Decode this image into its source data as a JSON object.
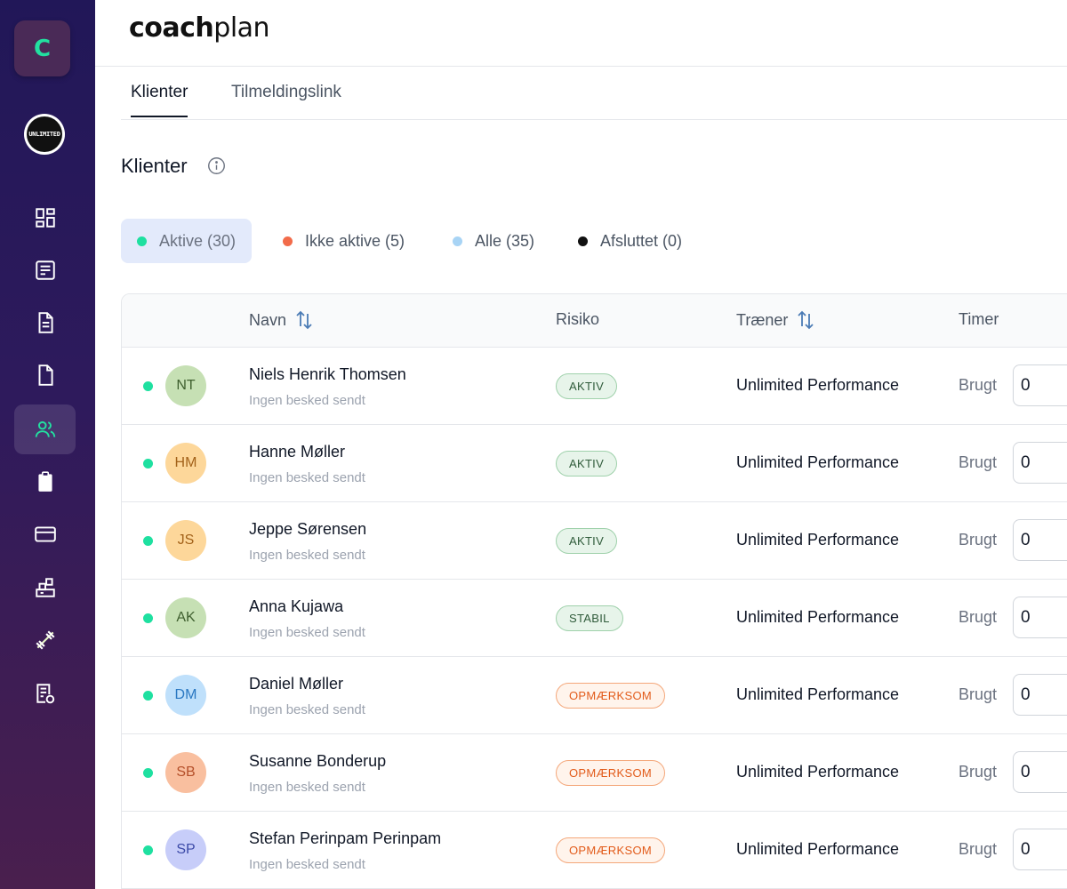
{
  "sidebar": {
    "app_initial": "C",
    "org_logo_text": "UNLIMITED",
    "nav": [
      {
        "icon": "dashboard-icon"
      },
      {
        "icon": "form-icon"
      },
      {
        "icon": "document-icon"
      },
      {
        "icon": "file-icon"
      },
      {
        "icon": "users-icon",
        "active": true
      },
      {
        "icon": "clipboard-icon"
      },
      {
        "icon": "credit-card-icon"
      },
      {
        "icon": "blocks-icon"
      },
      {
        "icon": "dumbbell-icon"
      },
      {
        "icon": "report-icon"
      }
    ]
  },
  "header": {
    "brand_bold": "coach",
    "brand_light": "plan"
  },
  "tabs": [
    {
      "label": "Klienter",
      "active": true
    },
    {
      "label": "Tilmeldingslink",
      "active": false
    }
  ],
  "section": {
    "title": "Klienter"
  },
  "filters": [
    {
      "label": "Aktive (30)",
      "color": "#1ee0a0",
      "active": true
    },
    {
      "label": "Ikke aktive (5)",
      "color": "#f26b4a",
      "active": false
    },
    {
      "label": "Alle (35)",
      "color": "#a8d4f5",
      "active": false
    },
    {
      "label": "Afsluttet (0)",
      "color": "#111111",
      "active": false
    }
  ],
  "table": {
    "headers": {
      "name": "Navn",
      "risk": "Risiko",
      "coach": "Træner",
      "hours": "Timer"
    },
    "rows": [
      {
        "initials": "NT",
        "avatar_bg": "#c6e0b4",
        "avatar_fg": "#3f5f2f",
        "name": "Niels Henrik Thomsen",
        "sub": "Ingen besked sendt",
        "risk": "AKTIV",
        "risk_tone": "green",
        "coach": "Unlimited Performance",
        "used_label": "Brugt",
        "used": "0"
      },
      {
        "initials": "HM",
        "avatar_bg": "#fdd79a",
        "avatar_fg": "#a3621a",
        "name": "Hanne Møller",
        "sub": "Ingen besked sendt",
        "risk": "AKTIV",
        "risk_tone": "green",
        "coach": "Unlimited Performance",
        "used_label": "Brugt",
        "used": "0"
      },
      {
        "initials": "JS",
        "avatar_bg": "#fdd79a",
        "avatar_fg": "#a3621a",
        "name": "Jeppe Sørensen",
        "sub": "Ingen besked sendt",
        "risk": "AKTIV",
        "risk_tone": "green",
        "coach": "Unlimited Performance",
        "used_label": "Brugt",
        "used": "0"
      },
      {
        "initials": "AK",
        "avatar_bg": "#c6e0b4",
        "avatar_fg": "#3f5f2f",
        "name": "Anna Kujawa",
        "sub": "Ingen besked sendt",
        "risk": "STABIL",
        "risk_tone": "green",
        "coach": "Unlimited Performance",
        "used_label": "Brugt",
        "used": "0"
      },
      {
        "initials": "DM",
        "avatar_bg": "#bfe0fb",
        "avatar_fg": "#2a78c2",
        "name": "Daniel Møller",
        "sub": "Ingen besked sendt",
        "risk": "OPMÆRKSOM",
        "risk_tone": "orange",
        "coach": "Unlimited Performance",
        "used_label": "Brugt",
        "used": "0"
      },
      {
        "initials": "SB",
        "avatar_bg": "#f9bf9f",
        "avatar_fg": "#b5502a",
        "name": "Susanne Bonderup",
        "sub": "Ingen besked sendt",
        "risk": "OPMÆRKSOM",
        "risk_tone": "orange",
        "coach": "Unlimited Performance",
        "used_label": "Brugt",
        "used": "0"
      },
      {
        "initials": "SP",
        "avatar_bg": "#c7cdf9",
        "avatar_fg": "#3c4aa8",
        "name": "Stefan Perinpam Perinpam",
        "sub": "Ingen besked sendt",
        "risk": "OPMÆRKSOM",
        "risk_tone": "orange",
        "coach": "Unlimited Performance",
        "used_label": "Brugt",
        "used": "0"
      }
    ]
  }
}
